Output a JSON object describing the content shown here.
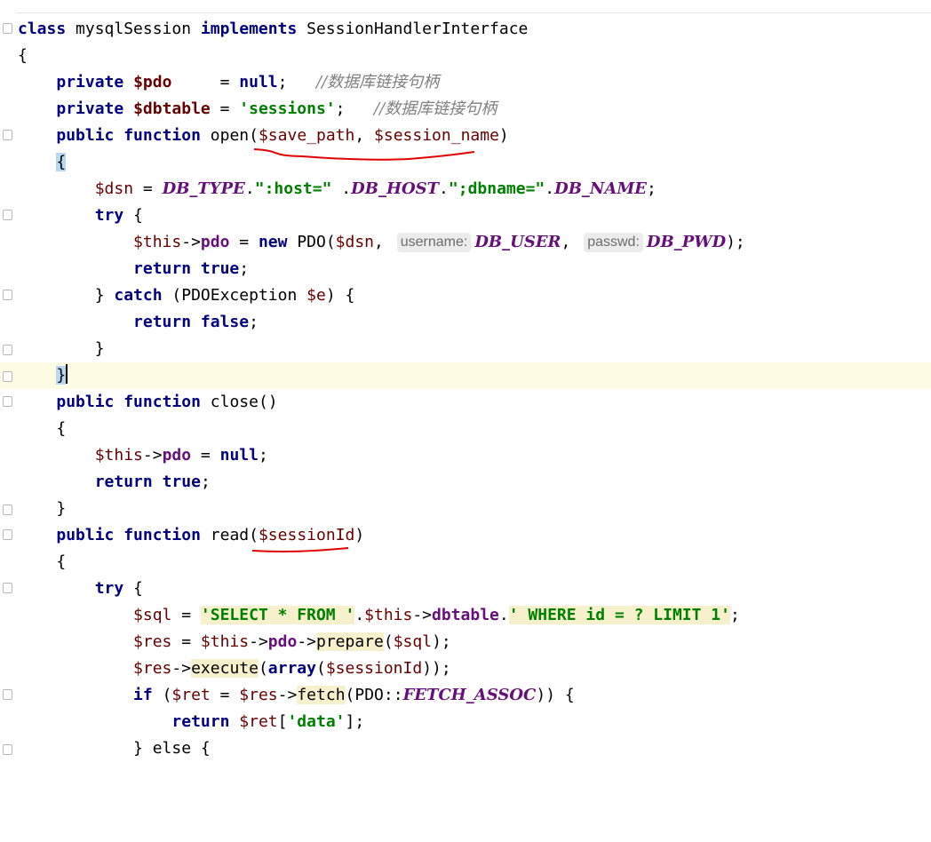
{
  "editor": {
    "language": "PHP",
    "lines": [
      {
        "t": "class mysqlSession implements SessionHandlerInterface"
      },
      {
        "t": "{"
      },
      {
        "a": "private",
        "b": "$pdo",
        "c": "     = ",
        "d": "null",
        "e": ";   ",
        "f": "//数据库链接句柄"
      },
      {
        "a": "private",
        "b": "$dbtable",
        "c": " = ",
        "d": "'sessions'",
        "e": ";   ",
        "f": "//数据库链接句柄"
      },
      {
        "a": "public function",
        "b": "open",
        "c": "$save_path",
        "d": "$session_name"
      },
      {
        "t": "{"
      },
      {
        "a": "$dsn",
        "b": "DB_TYPE",
        "c": "\":host=\"",
        "d": "DB_HOST",
        "e": "\";dbname=\"",
        "f": "DB_NAME"
      },
      {
        "a": "try",
        "b": " {"
      },
      {
        "a": "$this",
        "b": "pdo",
        "c": "new",
        "d": "PDO",
        "e": "$dsn",
        "f": "username:",
        "g": "DB_USER",
        "h": "passwd:",
        "i": "DB_PWD"
      },
      {
        "a": "return",
        "b": "true"
      },
      {
        "a": "catch",
        "b": "PDOException",
        "c": "$e"
      },
      {
        "a": "return",
        "b": "false"
      },
      {
        "t": "}"
      },
      {
        "t": "}"
      },
      {
        "a": "public function",
        "b": "close()"
      },
      {
        "t": "{"
      },
      {
        "a": "$this",
        "b": "pdo",
        "c": "null"
      },
      {
        "a": "return",
        "b": "true"
      },
      {
        "t": "}"
      },
      {
        "a": "public function",
        "b": "read",
        "c": "$sessionId"
      },
      {
        "t": "{"
      },
      {
        "a": "try",
        "b": " {"
      },
      {
        "a": "$sql",
        "b": "'SELECT * FROM '",
        "c": "$this",
        "d": "dbtable",
        "e": "' WHERE id = ? LIMIT 1'"
      },
      {
        "a": "$res",
        "b": "$this",
        "c": "pdo",
        "d": "prepare",
        "e": "$sql"
      },
      {
        "a": "$res",
        "b": "execute",
        "c": "array",
        "d": "$sessionId"
      },
      {
        "a": "if",
        "b": "$ret",
        "c": "$res",
        "d": "fetch",
        "e": "PDO::",
        "f": "FETCH_ASSOC"
      },
      {
        "a": "return",
        "b": "$ret",
        "c": "'data'"
      },
      {
        "a": "} else {"
      }
    ]
  },
  "colors": {
    "keyword": "#000080",
    "variable": "#660000",
    "property": "#660e7a",
    "string": "#008000",
    "comment": "#808080",
    "current_line": "#fdfbe3",
    "annotation": "#e00000"
  }
}
